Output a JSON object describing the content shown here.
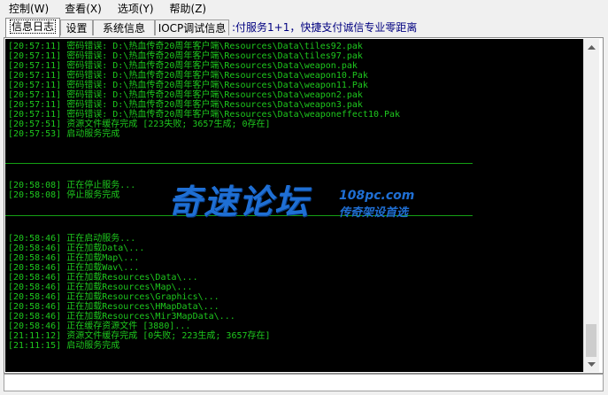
{
  "menu": [
    {
      "label": "控制(W)"
    },
    {
      "label": "查看(X)"
    },
    {
      "label": "选项(Y)"
    },
    {
      "label": "帮助(Z)"
    }
  ],
  "tabs": [
    {
      "label": "信息日志",
      "active": true
    },
    {
      "label": "设置",
      "active": false
    },
    {
      "label": "系统信息",
      "active": false
    },
    {
      "label": "IOCP调试信息",
      "active": false
    }
  ],
  "marquee": ":付服务1+1，快捷支付诚信专业零距离",
  "log": {
    "block1": [
      "[20:57:11] 密码错误: D:\\热血传奇20周年客户端\\Resources\\Data\\tiles92.pak",
      "[20:57:11] 密码错误: D:\\热血传奇20周年客户端\\Resources\\Data\\tiles97.pak",
      "[20:57:11] 密码错误: D:\\热血传奇20周年客户端\\Resources\\Data\\weapon.pak",
      "[20:57:11] 密码错误: D:\\热血传奇20周年客户端\\Resources\\Data\\weapon10.Pak",
      "[20:57:11] 密码错误: D:\\热血传奇20周年客户端\\Resources\\Data\\weapon11.Pak",
      "[20:57:11] 密码错误: D:\\热血传奇20周年客户端\\Resources\\Data\\weapon2.pak",
      "[20:57:11] 密码错误: D:\\热血传奇20周年客户端\\Resources\\Data\\weapon3.pak",
      "[20:57:11] 密码错误: D:\\热血传奇20周年客户端\\Resources\\Data\\weaponeffect10.Pak",
      "[20:57:51] 资源文件缓存完成 [223失败; 3657生成; 0存在]",
      "[20:57:53] 启动服务完成"
    ],
    "block2": [
      "[20:58:08] 正在停止服务...",
      "[20:58:08] 停止服务完成"
    ],
    "block3": [
      "[20:58:46] 正在启动服务...",
      "[20:58:46] 正在加载Data\\...",
      "[20:58:46] 正在加载Map\\...",
      "[20:58:46] 正在加载Wav\\...",
      "[20:58:46] 正在加载Resources\\Data\\...",
      "[20:58:46] 正在加载Resources\\Map\\...",
      "[20:58:46] 正在加载Resources\\Graphics\\...",
      "[20:58:46] 正在加载Resources\\HMapData\\...",
      "[20:58:46] 正在加载Resources\\Mir3MapData\\...",
      "[20:58:46] 正在缓存资源文件 [3880]...",
      "[21:11:12] 资源文件缓存完成 [0失败; 223生成; 3657存在]",
      "[21:11:15] 启动服务完成"
    ]
  },
  "watermark": {
    "main": "奇速论坛",
    "url": "108pc.com",
    "sub": "传奇架设首选"
  },
  "colors": {
    "log_bg": "#000000",
    "log_text": "#1ec81e",
    "separator": "#14a014",
    "watermark": "#1f6fd4"
  },
  "icons": {
    "scroll_up": "up-arrow-icon",
    "scroll_down": "down-arrow-icon"
  }
}
